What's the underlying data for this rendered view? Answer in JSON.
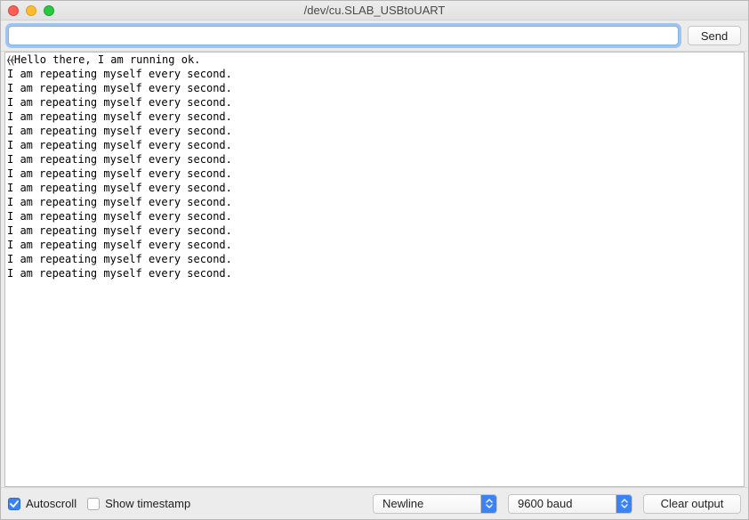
{
  "window": {
    "title": "/dev/cu.SLAB_USBtoUART"
  },
  "toolbar": {
    "send_label": "Send",
    "input_value": ""
  },
  "console": {
    "lines": [
      "⦑⦑Hello there, I am running ok.",
      "I am repeating myself every second.",
      "I am repeating myself every second.",
      "I am repeating myself every second.",
      "I am repeating myself every second.",
      "I am repeating myself every second.",
      "I am repeating myself every second.",
      "I am repeating myself every second.",
      "I am repeating myself every second.",
      "I am repeating myself every second.",
      "I am repeating myself every second.",
      "I am repeating myself every second.",
      "I am repeating myself every second.",
      "I am repeating myself every second.",
      "I am repeating myself every second.",
      "I am repeating myself every second."
    ]
  },
  "footer": {
    "autoscroll_label": "Autoscroll",
    "autoscroll_checked": true,
    "timestamp_label": "Show timestamp",
    "timestamp_checked": false,
    "line_ending_value": "Newline",
    "baud_value": "9600 baud",
    "clear_label": "Clear output"
  }
}
